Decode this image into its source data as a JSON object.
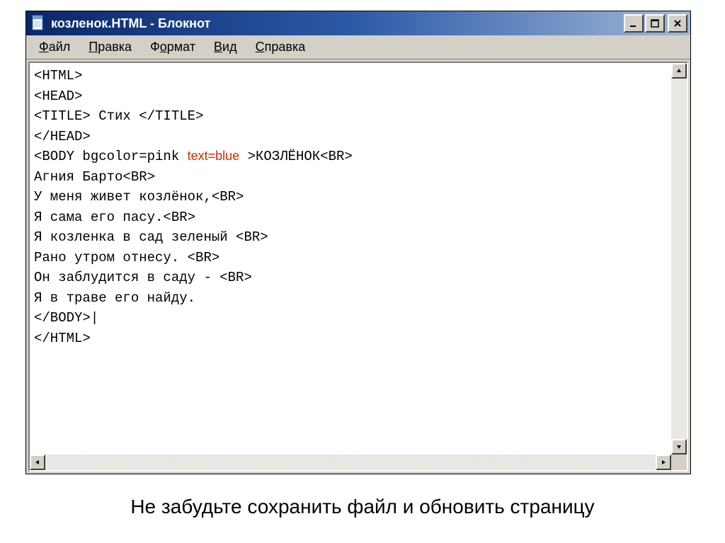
{
  "titlebar": {
    "title": "козленок.HTML - Блокнот"
  },
  "menu": {
    "items": [
      {
        "underline": "Ф",
        "rest": "айл"
      },
      {
        "underline": "П",
        "rest": "равка"
      },
      {
        "underline": "",
        "rest": "Ф",
        "underline2": "о",
        "rest2": "рмат"
      },
      {
        "underline": "В",
        "rest": "ид"
      },
      {
        "underline": "С",
        "rest": "правка"
      }
    ]
  },
  "editor": {
    "lines": [
      "<HTML>",
      "<HEAD>",
      "<TITLE> Стих </TITLE>",
      "</HEAD>",
      "<BODY bgcolor=pink ",
      "text=blue",
      " >КОЗЛЁНОК<BR>",
      "Агния Барто<BR>",
      "У меня живет козлёнок,<BR>",
      "Я сама его пасу.<BR>",
      "Я козленка в сад зеленый <BR>",
      "Рано утром отнесу. <BR>",
      "Он заблудится в саду - <BR>",
      "Я в траве его найду.",
      "</BODY>",
      "|",
      "</HTML>"
    ]
  },
  "caption": "Не забудьте сохранить файл и обновить страницу"
}
